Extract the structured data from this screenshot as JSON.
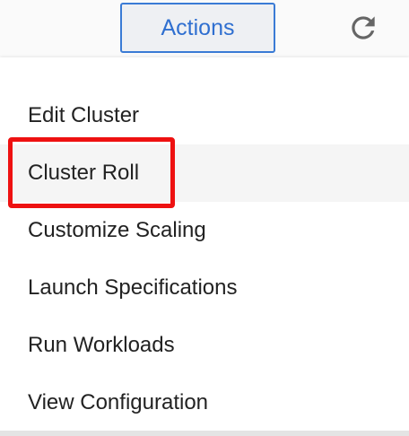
{
  "toolbar": {
    "actions_label": "Actions",
    "refresh_icon": "refresh-icon"
  },
  "menu": {
    "items": [
      {
        "label": "Edit Cluster"
      },
      {
        "label": "Cluster Roll",
        "hovered": true,
        "highlighted": true
      },
      {
        "label": "Customize Scaling"
      },
      {
        "label": "Launch Specifications"
      },
      {
        "label": "Run Workloads"
      },
      {
        "label": "View Configuration"
      }
    ]
  },
  "colors": {
    "accent": "#2f6fd0",
    "highlight": "#ee1111"
  }
}
